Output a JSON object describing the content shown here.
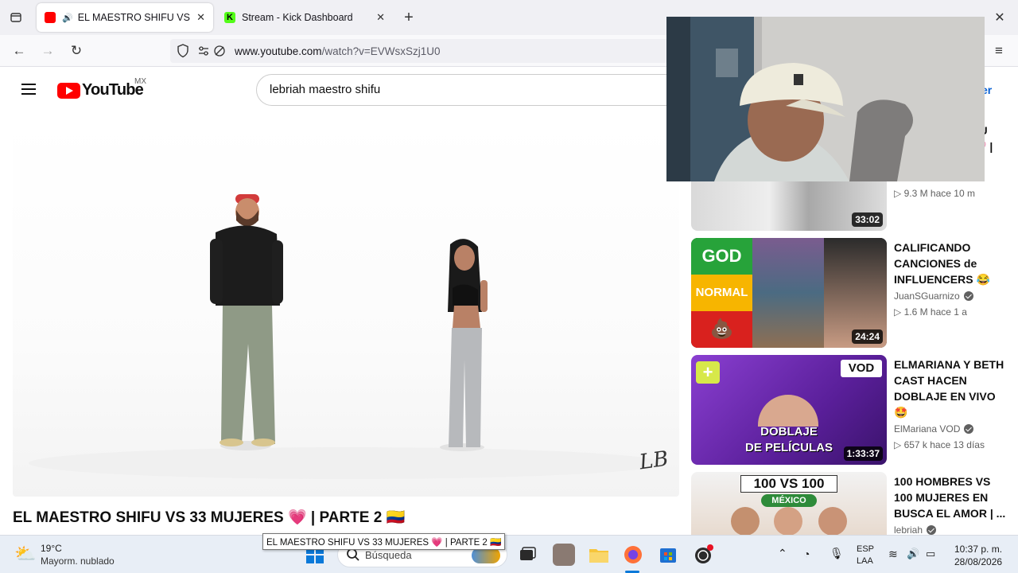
{
  "browser": {
    "tabs": [
      {
        "title": "EL MAESTRO SHIFU VS 33 MUJERES",
        "active": true
      },
      {
        "title": "Stream - Kick Dashboard",
        "active": false
      }
    ],
    "url_host": "www.youtube.com",
    "url_path": "/watch?v=EVWsxSzj1U0"
  },
  "youtube": {
    "logo_text": "YouTube",
    "country_code": "MX",
    "search_query": "lebriah maestro shifu",
    "header_right_partial": "er",
    "video_title": "EL MAESTRO SHIFU VS 33 MUJERES 💗 | PARTE 2 🇨🇴",
    "watermark": "LB"
  },
  "sidebar": {
    "partial_card": {
      "title_line1": "FU",
      "title_line2": "💗 |",
      "stats": "▷ 9.3 M   hace 10 m",
      "duration": "33:02"
    },
    "cards": [
      {
        "title": "CALIFICANDO CANCIONES de INFLUENCERS 😂",
        "channel": "JuanSGuarnizo",
        "verified": true,
        "stats": "▷ 1.6 M   hace 1 a",
        "duration": "24:24",
        "thumb_text": [
          "GOD",
          "NORMAL"
        ]
      },
      {
        "title": "ELMARIANA Y BETH CAST HACEN DOBLAJE EN VIVO 🤩",
        "channel": "ElMariana VOD",
        "verified": true,
        "stats": "▷ 657 k   hace 13 días",
        "duration": "1:33:37",
        "thumb_text": [
          "VOD",
          "DOBLAJE",
          "DE PELÍCULAS"
        ]
      },
      {
        "title": "100 HOMBRES VS 100 MUJERES EN BUSCA EL AMOR | ...",
        "channel": "lebriah",
        "verified": true,
        "stats": "",
        "duration": "",
        "thumb_text": [
          "100 VS 100",
          "MÉXICO"
        ]
      }
    ]
  },
  "taskbar": {
    "weather_temp": "19°C",
    "weather_desc": "Mayorm. nublado",
    "search_placeholder": "Búsqueda",
    "tooltip": "EL MAESTRO SHIFU VS 33 MUJERES 💗 | PARTE 2 🇨🇴",
    "lang_line1": "ESP",
    "lang_line2": "LAA",
    "time": "10:37 p. m.",
    "date": "28/08/2026"
  },
  "colors": {
    "yt_red": "#ff0000",
    "kick_green": "#53fc18",
    "taskbar_bg": "#e8eef6"
  }
}
